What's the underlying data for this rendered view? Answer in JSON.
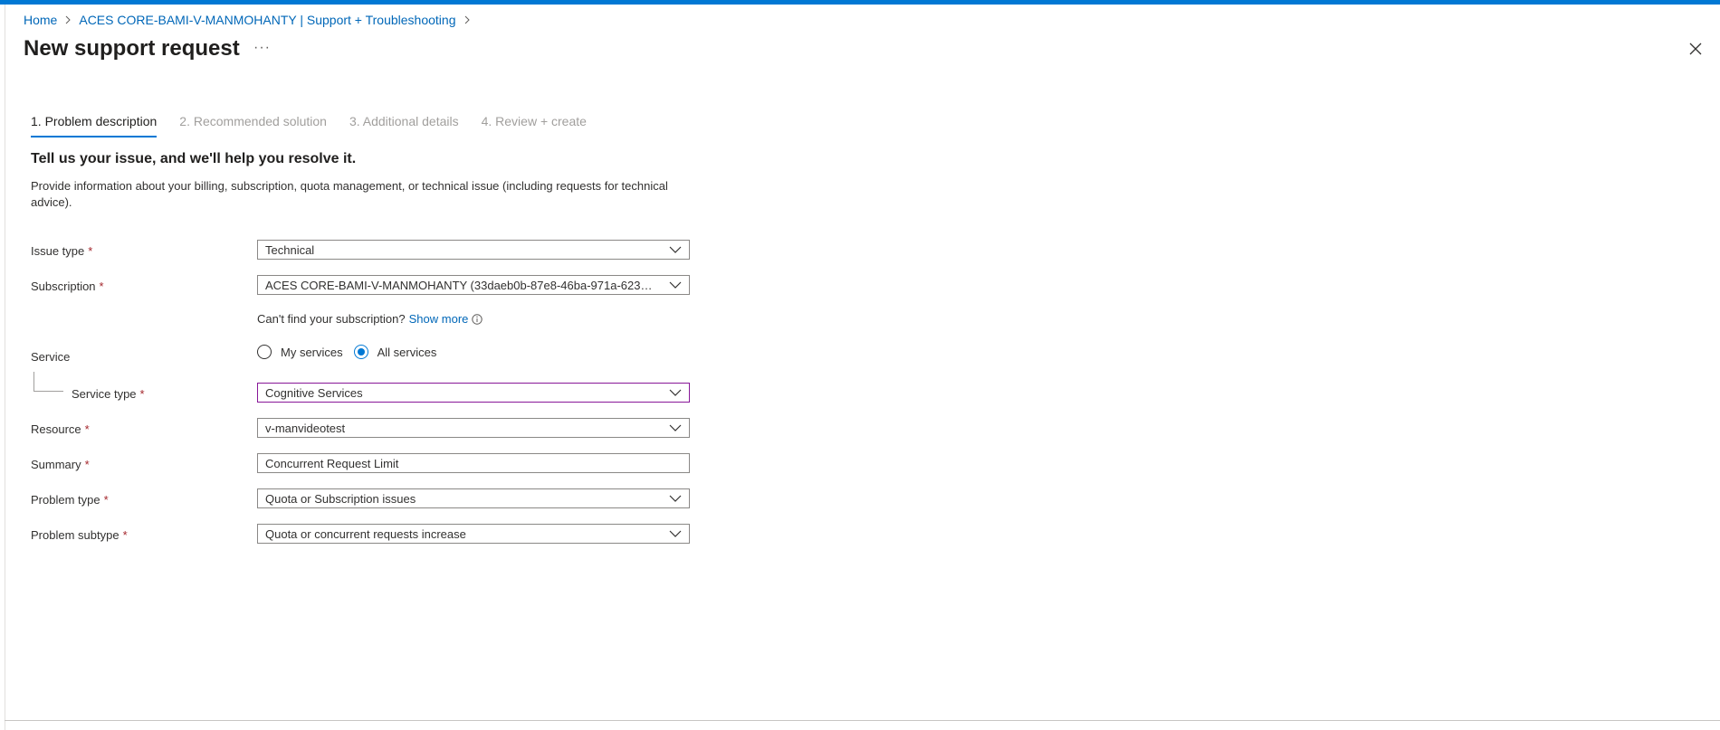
{
  "breadcrumb": {
    "home": "Home",
    "resource": "ACES CORE-BAMI-V-MANMOHANTY | Support + Troubleshooting"
  },
  "page": {
    "title": "New support request",
    "more": "···"
  },
  "tabs": [
    {
      "label": "1. Problem description",
      "active": true
    },
    {
      "label": "2. Recommended solution",
      "active": false
    },
    {
      "label": "3. Additional details",
      "active": false
    },
    {
      "label": "4. Review + create",
      "active": false
    }
  ],
  "intro": {
    "heading": "Tell us your issue, and we'll help you resolve it.",
    "description": "Provide information about your billing, subscription, quota management, or technical issue (including requests for technical advice)."
  },
  "form": {
    "required_mark": "*",
    "issue_type": {
      "label": "Issue type",
      "value": "Technical"
    },
    "subscription": {
      "label": "Subscription",
      "value": "ACES CORE-BAMI-V-MANMOHANTY (33daeb0b-87e8-46ba-971a-623216..."
    },
    "subscription_hint": {
      "text": "Can't find your subscription?",
      "link": "Show more"
    },
    "service": {
      "label": "Service",
      "option_my": "My services",
      "option_all": "All services",
      "selected": "All services"
    },
    "service_type": {
      "label": "Service type",
      "value": "Cognitive Services"
    },
    "resource": {
      "label": "Resource",
      "value": "v-manvideotest"
    },
    "summary": {
      "label": "Summary",
      "value": "Concurrent Request Limit"
    },
    "problem_type": {
      "label": "Problem type",
      "value": "Quota or Subscription issues"
    },
    "problem_subtype": {
      "label": "Problem subtype",
      "value": "Quota or concurrent requests increase"
    }
  },
  "colors": {
    "accent": "#0078d4",
    "link": "#0067b8",
    "required": "#a4262c",
    "focus_border": "#881798"
  },
  "icons": {
    "close": "close-icon",
    "chevron": "chevron-down-icon",
    "info": "info-icon",
    "breadcrumb_sep": "chevron-right-icon"
  }
}
